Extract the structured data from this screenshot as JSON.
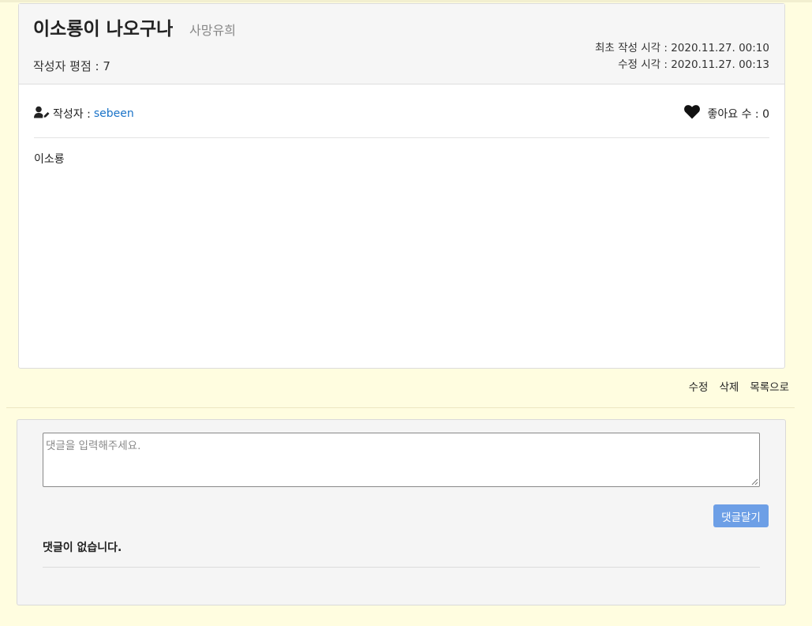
{
  "post": {
    "title": "이소룡이 나오구나",
    "category": "사망유희",
    "rating": "작성자 평점 : 7",
    "created_at": "최초 작성 시각 : 2020.11.27. 00:10",
    "modified_at": "수정 시각 : 2020.11.27. 00:13",
    "author_label": "작성자 :",
    "author": "sebeen",
    "likes": "좋아요 수 : 0",
    "content": "이소룡"
  },
  "actions": {
    "edit": "수정",
    "delete": "삭제",
    "list": "목록으로"
  },
  "comments": {
    "placeholder": "댓글을 입력해주세요.",
    "submit": "댓글달기",
    "empty": "댓글이 없습니다."
  },
  "icons": {
    "author": "user-edit-icon",
    "likes": "heart-icon"
  },
  "colors": {
    "background": "#fffde0",
    "link": "#1a73c8",
    "submit_button": "#6d9fe6"
  }
}
